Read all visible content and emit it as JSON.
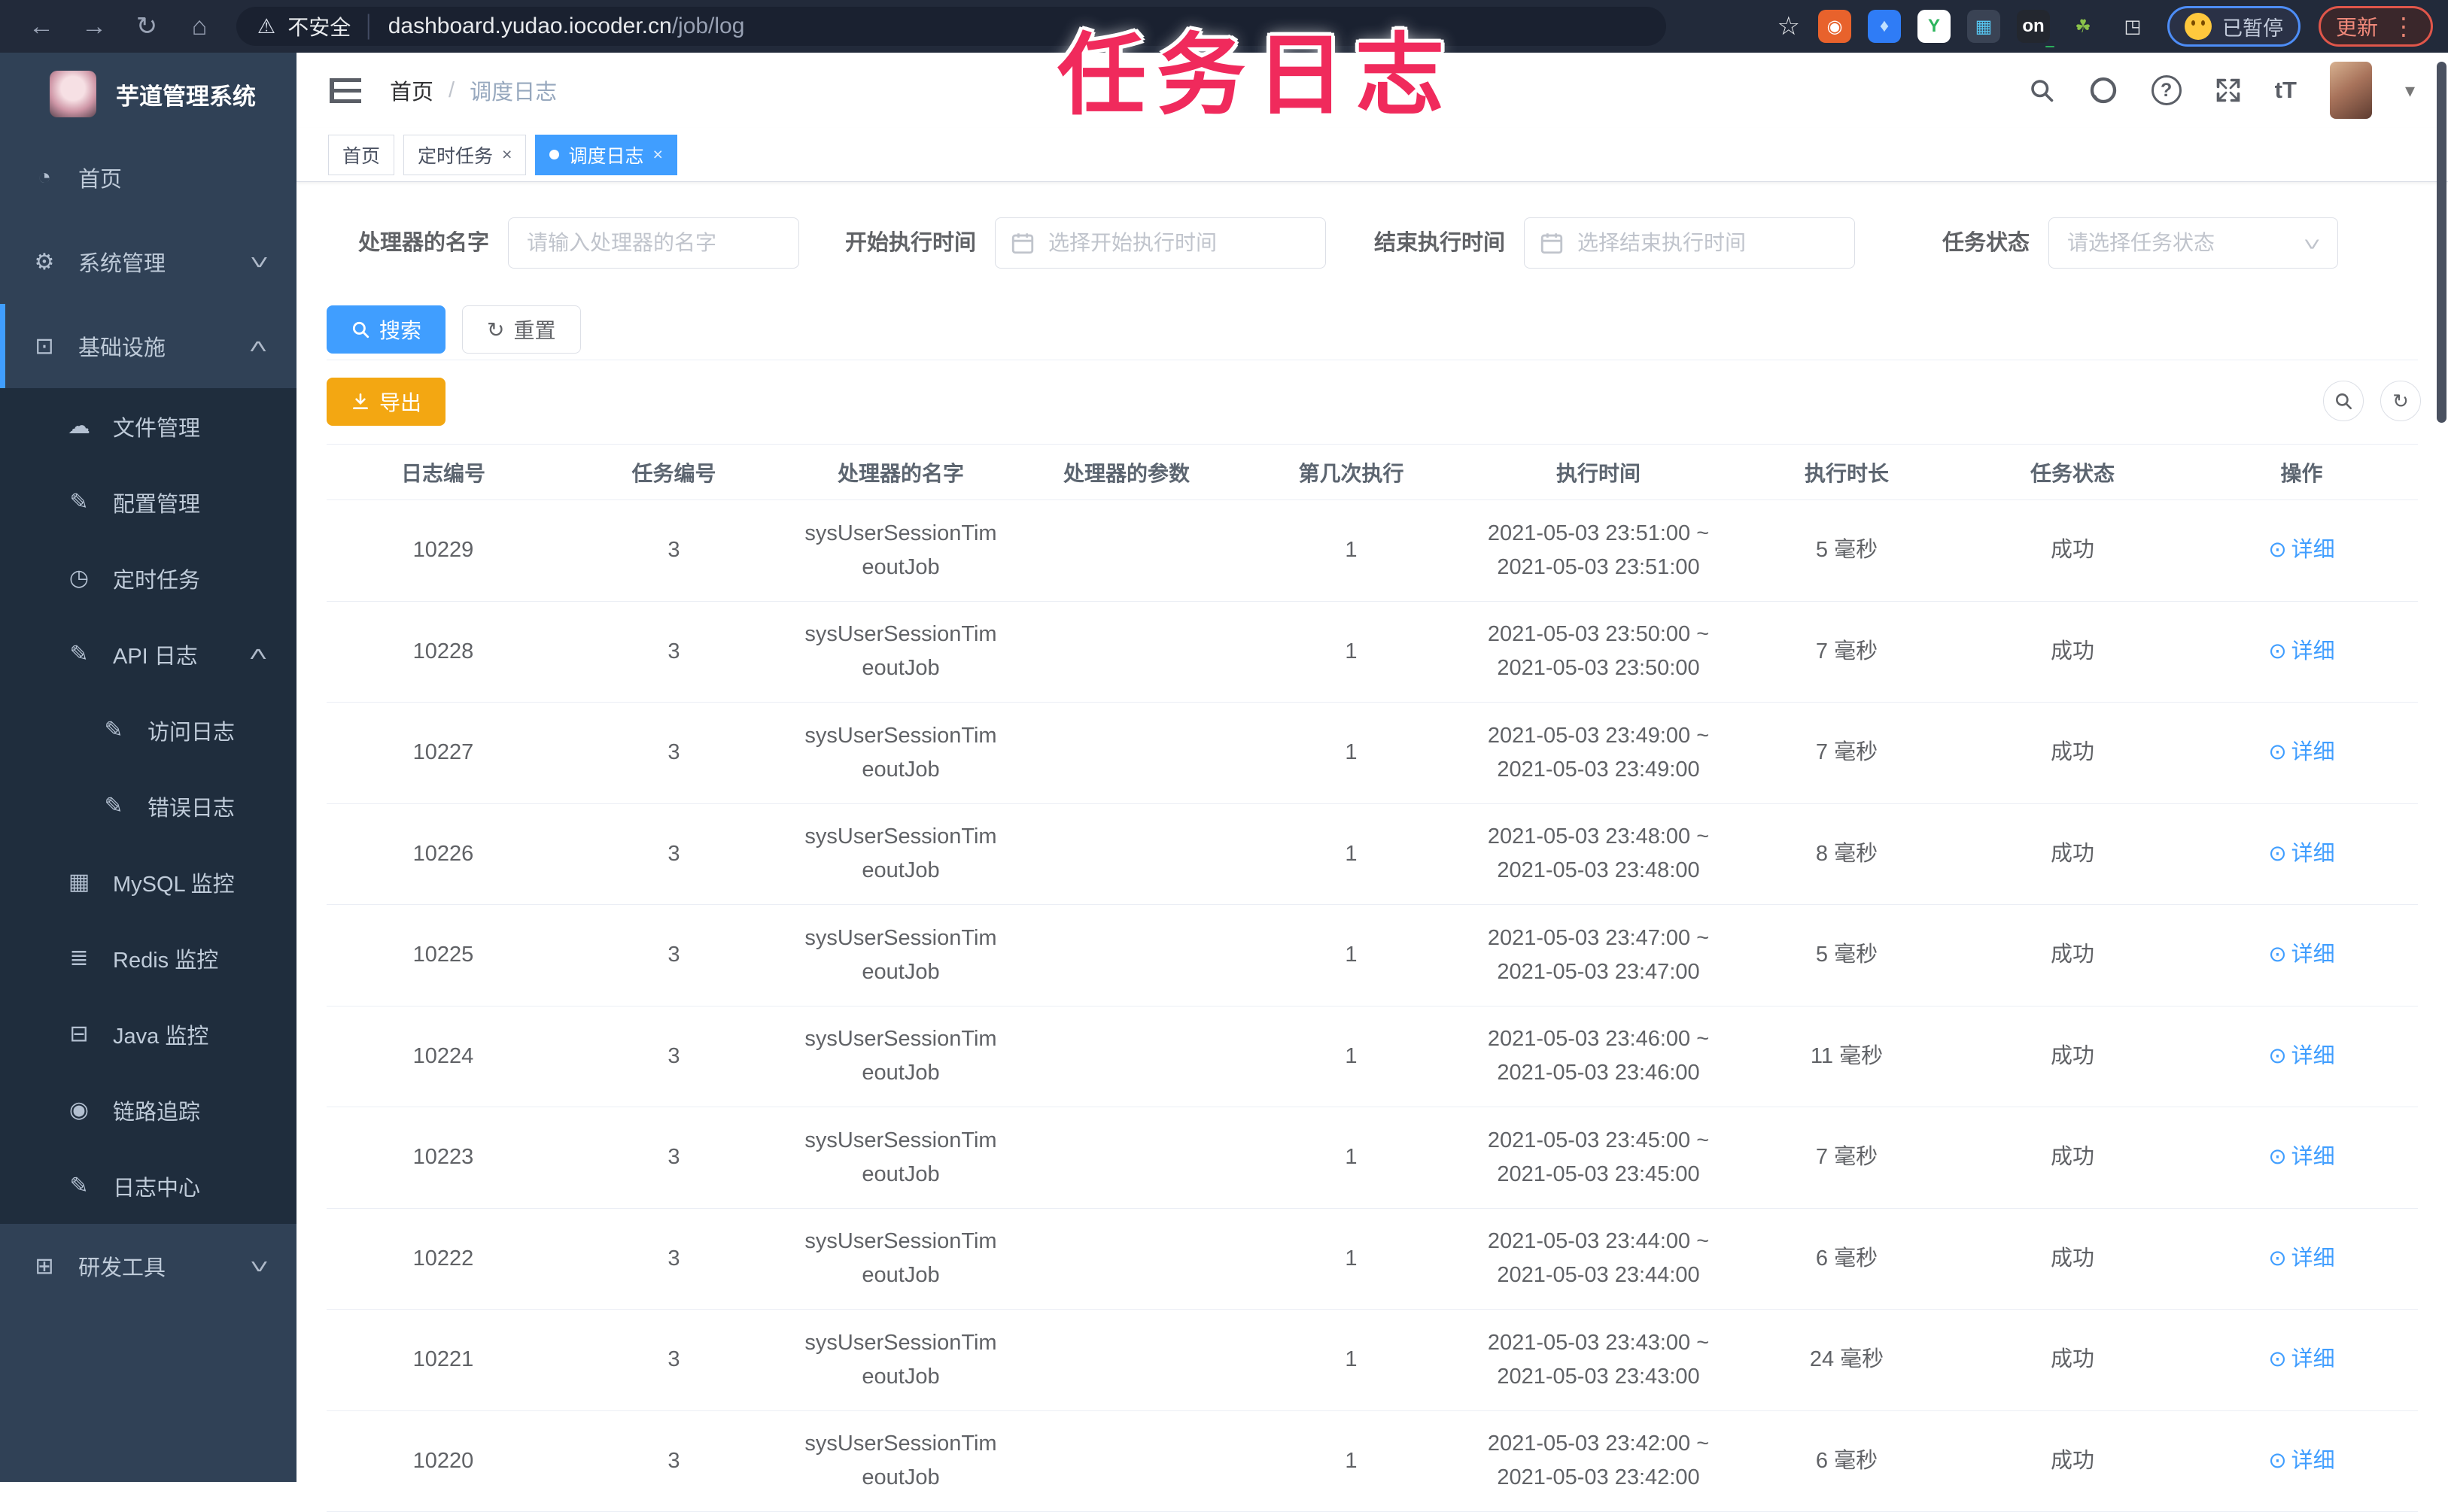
{
  "annotation": {
    "text": "任务日志",
    "color": "#F02A5C"
  },
  "browser": {
    "back_icon": "←",
    "forward_icon": "→",
    "reload_icon": "↻",
    "home_icon": "⌂",
    "warning_icon": "⚠",
    "security_label": "不安全",
    "url_separator": "│",
    "url_host": "dashboard.yudao.iocoder.cn",
    "url_path": "/job/log",
    "bookmark_star_icon": "☆",
    "extensions": [
      {
        "id": "shield",
        "glyph": "◉",
        "bg": "#E8622C",
        "fg": "#FFFFFF"
      },
      {
        "id": "lamp",
        "glyph": "♦",
        "bg": "#2F7CF6",
        "fg": "#BFE0FF"
      },
      {
        "id": "green-y",
        "glyph": "Y",
        "bg": "#FFFFFF",
        "fg": "#2DB55D"
      },
      {
        "id": "grid",
        "glyph": "▦",
        "bg": "#3A4354",
        "fg": "#56C7F2"
      },
      {
        "id": "on-switch",
        "glyph": "on",
        "bg": "#23272F",
        "fg": "#FFFFFF",
        "badge": "#2BAE5C"
      },
      {
        "id": "leaf",
        "glyph": "☘",
        "bg": "transparent",
        "fg": "#8BC34A"
      },
      {
        "id": "puzzle",
        "glyph": "◳",
        "bg": "transparent",
        "fg": "#E8EAED"
      }
    ],
    "paused_badge": "已暂停",
    "update_label": "更新",
    "menu_dots_icon": "⋮"
  },
  "sidebar": {
    "app_title": "芋道管理系统",
    "items": [
      {
        "id": "home",
        "label": "首页",
        "icon": "dashboard-icon",
        "glyph": "◔",
        "level": 1
      },
      {
        "id": "system",
        "label": "系统管理",
        "icon": "gear-icon",
        "glyph": "⚙",
        "level": 1,
        "chevron": "down"
      },
      {
        "id": "infra",
        "label": "基础设施",
        "icon": "monitor-icon",
        "glyph": "⊡",
        "level": 1,
        "chevron": "up",
        "active_bar": true
      },
      {
        "id": "file",
        "label": "文件管理",
        "icon": "upload-cloud-icon",
        "glyph": "☁",
        "level": 2,
        "sub": true
      },
      {
        "id": "config",
        "label": "配置管理",
        "icon": "edit-icon",
        "glyph": "✎",
        "level": 2,
        "sub": true
      },
      {
        "id": "job",
        "label": "定时任务",
        "icon": "timer-icon",
        "glyph": "◷",
        "level": 2,
        "sub": true
      },
      {
        "id": "api-log",
        "label": "API 日志",
        "icon": "log-icon",
        "glyph": "✎",
        "level": 2,
        "sub": true,
        "chevron": "up"
      },
      {
        "id": "access-log",
        "label": "访问日志",
        "icon": "access-log-icon",
        "glyph": "✎",
        "level": 3,
        "sub": true
      },
      {
        "id": "error-log",
        "label": "错误日志",
        "icon": "error-log-icon",
        "glyph": "✎",
        "level": 3,
        "sub": true
      },
      {
        "id": "mysql",
        "label": "MySQL 监控",
        "icon": "mysql-monitor-icon",
        "glyph": "▦",
        "level": 2,
        "sub": true
      },
      {
        "id": "redis",
        "label": "Redis 监控",
        "icon": "redis-monitor-icon",
        "glyph": "≣",
        "level": 2,
        "sub": true
      },
      {
        "id": "java",
        "label": "Java 监控",
        "icon": "java-monitor-icon",
        "glyph": "⊟",
        "level": 2,
        "sub": true
      },
      {
        "id": "trace",
        "label": "链路追踪",
        "icon": "eye-icon",
        "glyph": "◉",
        "level": 2,
        "sub": true
      },
      {
        "id": "log-center",
        "label": "日志中心",
        "icon": "log-center-icon",
        "glyph": "✎",
        "level": 2,
        "sub": true
      },
      {
        "id": "dev-tools",
        "label": "研发工具",
        "icon": "toolbox-icon",
        "glyph": "⊞",
        "level": 1,
        "chevron": "down"
      }
    ]
  },
  "header": {
    "breadcrumb_home": "首页",
    "breadcrumb_separator": "/",
    "breadcrumb_current": "调度日志",
    "help_icon": "?",
    "font_size_icon": "tT",
    "caret_icon": "▾"
  },
  "tabs": {
    "close_icon": "×",
    "items": [
      {
        "id": "home",
        "label": "首页",
        "closable": false,
        "active": false
      },
      {
        "id": "job",
        "label": "定时任务",
        "closable": true,
        "active": false
      },
      {
        "id": "job-log",
        "label": "调度日志",
        "closable": true,
        "active": true
      }
    ]
  },
  "filters": {
    "handler_label": "处理器的名字",
    "handler_placeholder": "请输入处理器的名字",
    "begin_label": "开始执行时间",
    "begin_placeholder": "选择开始执行时间",
    "end_label": "结束执行时间",
    "end_placeholder": "选择结束执行时间",
    "status_label": "任务状态",
    "status_placeholder": "请选择任务状态"
  },
  "toolbar": {
    "search": "搜索",
    "reset": "重置",
    "export": "导出",
    "refresh_tool_icon": "↻"
  },
  "accent_colors": {
    "primary": "#409EFF",
    "warning": "#F3A712",
    "sidebar_bg": "#304156",
    "submenu_bg": "#1F2D3D",
    "annotation_pink": "#F02A5C"
  },
  "table": {
    "columns": [
      {
        "id": "log-id",
        "label": "日志编号"
      },
      {
        "id": "job-id",
        "label": "任务编号"
      },
      {
        "id": "handler-name",
        "label": "处理器的名字"
      },
      {
        "id": "handler-param",
        "label": "处理器的参数"
      },
      {
        "id": "execute-index",
        "label": "第几次执行"
      },
      {
        "id": "execute-time",
        "label": "执行时间"
      },
      {
        "id": "duration",
        "label": "执行时长"
      },
      {
        "id": "status",
        "label": "任务状态"
      },
      {
        "id": "actions",
        "label": "操作"
      }
    ],
    "detail_label": "详细",
    "detail_icon": "⊙",
    "rows": [
      {
        "log_id": "10229",
        "job_id": "3",
        "handler_line1": "sysUserSessionTim",
        "handler_line2": "eoutJob",
        "param": "",
        "times": "1",
        "time_start": "2021-05-03 23:51:00 ~",
        "time_end": "2021-05-03 23:51:00",
        "duration": "5 毫秒",
        "status": "成功"
      },
      {
        "log_id": "10228",
        "job_id": "3",
        "handler_line1": "sysUserSessionTim",
        "handler_line2": "eoutJob",
        "param": "",
        "times": "1",
        "time_start": "2021-05-03 23:50:00 ~",
        "time_end": "2021-05-03 23:50:00",
        "duration": "7 毫秒",
        "status": "成功"
      },
      {
        "log_id": "10227",
        "job_id": "3",
        "handler_line1": "sysUserSessionTim",
        "handler_line2": "eoutJob",
        "param": "",
        "times": "1",
        "time_start": "2021-05-03 23:49:00 ~",
        "time_end": "2021-05-03 23:49:00",
        "duration": "7 毫秒",
        "status": "成功"
      },
      {
        "log_id": "10226",
        "job_id": "3",
        "handler_line1": "sysUserSessionTim",
        "handler_line2": "eoutJob",
        "param": "",
        "times": "1",
        "time_start": "2021-05-03 23:48:00 ~",
        "time_end": "2021-05-03 23:48:00",
        "duration": "8 毫秒",
        "status": "成功"
      },
      {
        "log_id": "10225",
        "job_id": "3",
        "handler_line1": "sysUserSessionTim",
        "handler_line2": "eoutJob",
        "param": "",
        "times": "1",
        "time_start": "2021-05-03 23:47:00 ~",
        "time_end": "2021-05-03 23:47:00",
        "duration": "5 毫秒",
        "status": "成功"
      },
      {
        "log_id": "10224",
        "job_id": "3",
        "handler_line1": "sysUserSessionTim",
        "handler_line2": "eoutJob",
        "param": "",
        "times": "1",
        "time_start": "2021-05-03 23:46:00 ~",
        "time_end": "2021-05-03 23:46:00",
        "duration": "11 毫秒",
        "status": "成功"
      },
      {
        "log_id": "10223",
        "job_id": "3",
        "handler_line1": "sysUserSessionTim",
        "handler_line2": "eoutJob",
        "param": "",
        "times": "1",
        "time_start": "2021-05-03 23:45:00 ~",
        "time_end": "2021-05-03 23:45:00",
        "duration": "7 毫秒",
        "status": "成功"
      },
      {
        "log_id": "10222",
        "job_id": "3",
        "handler_line1": "sysUserSessionTim",
        "handler_line2": "eoutJob",
        "param": "",
        "times": "1",
        "time_start": "2021-05-03 23:44:00 ~",
        "time_end": "2021-05-03 23:44:00",
        "duration": "6 毫秒",
        "status": "成功"
      },
      {
        "log_id": "10221",
        "job_id": "3",
        "handler_line1": "sysUserSessionTim",
        "handler_line2": "eoutJob",
        "param": "",
        "times": "1",
        "time_start": "2021-05-03 23:43:00 ~",
        "time_end": "2021-05-03 23:43:00",
        "duration": "24 毫秒",
        "status": "成功"
      },
      {
        "log_id": "10220",
        "job_id": "3",
        "handler_line1": "sysUserSessionTim",
        "handler_line2": "eoutJob",
        "param": "",
        "times": "1",
        "time_start": "2021-05-03 23:42:00 ~",
        "time_end": "2021-05-03 23:42:00",
        "duration": "6 毫秒",
        "status": "成功"
      }
    ]
  }
}
